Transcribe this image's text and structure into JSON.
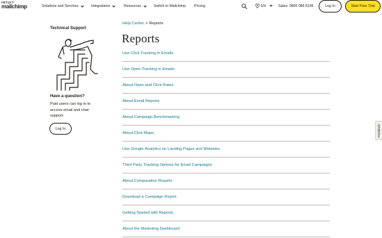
{
  "header": {
    "logo_line1": "INTUIT",
    "logo_line2": "mailchimp",
    "nav": [
      {
        "label": "Solutions and Services",
        "has_dropdown": true
      },
      {
        "label": "Integrations",
        "has_dropdown": true
      },
      {
        "label": "Resources",
        "has_dropdown": true
      },
      {
        "label": "Switch to Mailchimp",
        "has_dropdown": false
      },
      {
        "label": "Pricing",
        "has_dropdown": false
      }
    ],
    "search_icon": "search-icon",
    "locale": "EN",
    "sales": "Sales: 0800 086 8196",
    "login_label": "Log In",
    "trial_label": "Start Free Trial",
    "trial_color": "#ffe01b"
  },
  "sidebar": {
    "title": "Technical Support",
    "question": "Have a question?",
    "paragraph": "Paid users can log in to access email and chat support.",
    "login_label": "Log In"
  },
  "main": {
    "breadcrumb": {
      "parent": "Help Center",
      "separator": ">",
      "current": "Reports"
    },
    "title": "Reports",
    "articles": [
      "Use Click Tracking in Emails",
      "Use Open Tracking in Emails",
      "About Open and Click Rates",
      "About Email Reports",
      "About Campaign Benchmarking",
      "About Click Maps",
      "Use Google Analytics on Landing Pages and Websites",
      "Third Party Tracking Options for Email Campaigns",
      "About Comparative Reports",
      "Download a Campaign Report",
      "Getting Started with Reports",
      "About the Marketing Dashboard"
    ],
    "link_color": "#007c89"
  },
  "feedback_label": "Feedback"
}
